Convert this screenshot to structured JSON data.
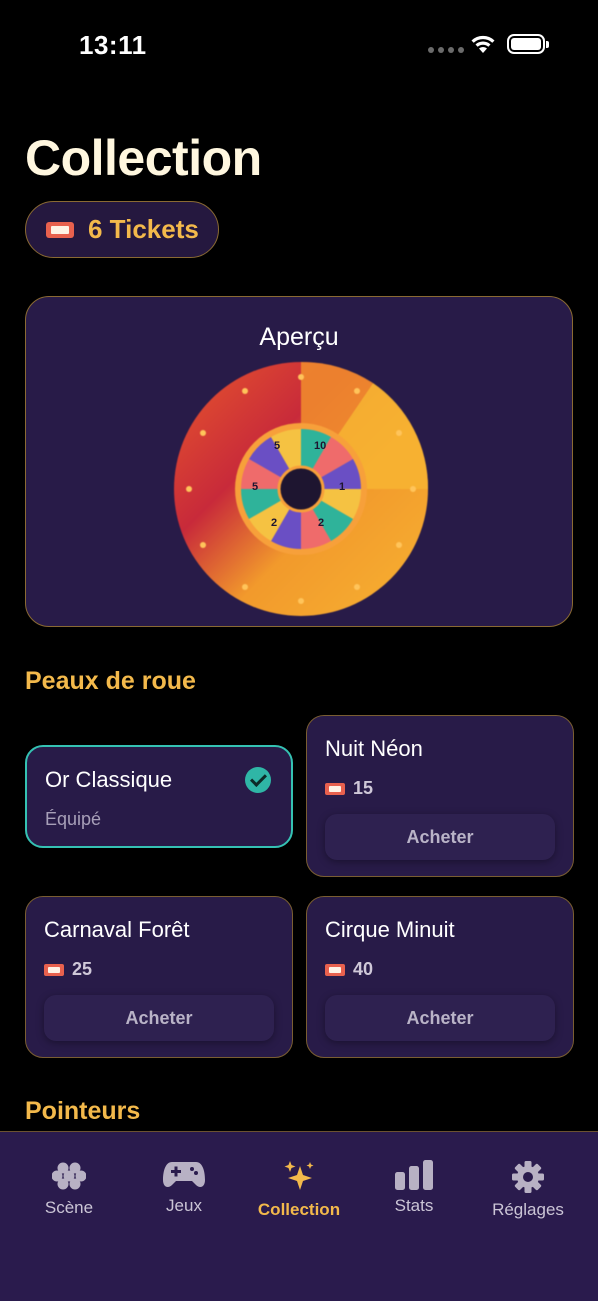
{
  "status_bar": {
    "time": "13:11"
  },
  "page": {
    "title": "Collection"
  },
  "tickets": {
    "label": "6 Tickets"
  },
  "preview": {
    "title": "Aperçu",
    "wheel_segments": [
      "5",
      "10",
      "1",
      "2",
      "2",
      "5"
    ]
  },
  "skins": {
    "section_title": "Peaux de roue",
    "items": [
      {
        "name": "Or Classique",
        "status": "Équipé",
        "equipped": true
      },
      {
        "name": "Nuit Néon",
        "price": "15",
        "action": "Acheter"
      },
      {
        "name": "Carnaval Forêt",
        "price": "25",
        "action": "Acheter"
      },
      {
        "name": "Cirque Minuit",
        "price": "40",
        "action": "Acheter"
      }
    ]
  },
  "pointers": {
    "section_title": "Pointeurs"
  },
  "tabbar": {
    "tabs": [
      {
        "label": "Scène",
        "icon": "flower-icon"
      },
      {
        "label": "Jeux",
        "icon": "gamepad-icon"
      },
      {
        "label": "Collection",
        "icon": "sparkles-icon",
        "active": true
      },
      {
        "label": "Stats",
        "icon": "bar-chart-icon"
      },
      {
        "label": "Réglages",
        "icon": "gear-icon"
      }
    ]
  },
  "colors": {
    "accent": "#f3b94b",
    "card_bg": "#281b48",
    "equipped_border": "#35c2b3",
    "tabbar_bg": "#2a1b4d"
  }
}
